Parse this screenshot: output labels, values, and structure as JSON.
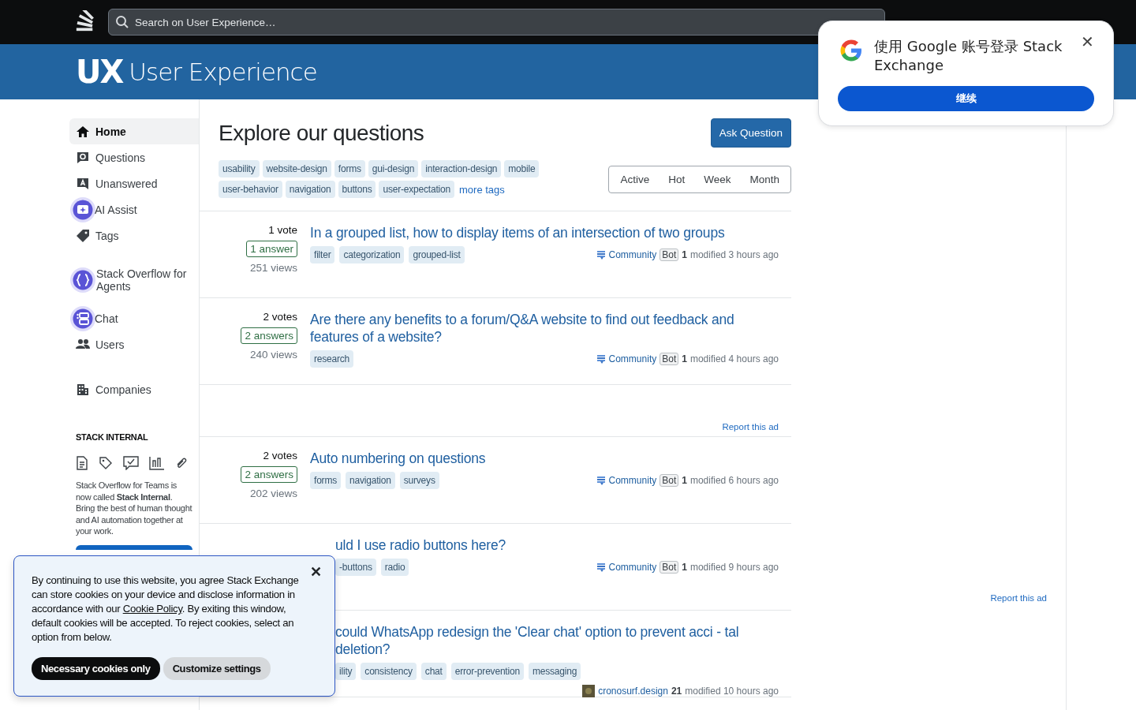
{
  "topbar": {
    "search": {
      "placeholder": "Search on User Experience…"
    }
  },
  "site": {
    "logo_mark": "UX",
    "name": "User Experience"
  },
  "sidebar": {
    "items": [
      {
        "label": "Home",
        "selected": true
      },
      {
        "label": "Questions",
        "selected": false
      },
      {
        "label": "Unanswered",
        "selected": false
      },
      {
        "label": "AI Assist",
        "selected": false
      },
      {
        "label": "Tags",
        "selected": false
      },
      {
        "label": "Stack Overflow for Agents",
        "selected": false
      },
      {
        "label": "Chat",
        "selected": false
      },
      {
        "label": "Users",
        "selected": false
      },
      {
        "label": "Companies",
        "selected": false
      }
    ],
    "internal": {
      "heading": "STACK INTERNAL",
      "text": "Stack Overflow for Teams is now called **Stack Internal**. Bring the best of human thought and AI automation together at your work."
    }
  },
  "main": {
    "title": "Explore our questions",
    "ask_button": "Ask Question",
    "tags": [
      "usability",
      "website-design",
      "forms",
      "gui-design",
      "interaction-design",
      "mobile",
      "user-behavior",
      "navigation",
      "buttons",
      "user-expectation"
    ],
    "more_tags": "more tags",
    "filters": [
      {
        "label": "Active",
        "selected": false
      },
      {
        "label": "Hot",
        "selected": false
      },
      {
        "label": "Week",
        "selected": false
      },
      {
        "label": "Month",
        "selected": false
      }
    ],
    "items": [
      {
        "kind": "question",
        "votes": "1 vote",
        "answers": "1 answer",
        "views": "251 views",
        "title": "In a grouped list, how to display items of an intersection of two groups",
        "tags": [
          "filter",
          "categorization",
          "grouped-list"
        ],
        "user": "Community",
        "badge": "Bot",
        "rep": "1",
        "modified": "modified 3 hours ago"
      },
      {
        "kind": "question",
        "votes": "2 votes",
        "answers": "2 answers",
        "views": "240 views",
        "title": "Are there any benefits to a forum/Q&A website to find out feedback and features of a website?",
        "tags": [
          "research"
        ],
        "user": "Community",
        "badge": "Bot",
        "rep": "1",
        "modified": "modified 4 hours ago"
      },
      {
        "kind": "ad",
        "report": "Report this ad"
      },
      {
        "kind": "question",
        "votes": "2 votes",
        "answers": "2 answers",
        "views": "202 views",
        "title": "Auto numbering on questions",
        "tags": [
          "forms",
          "navigation",
          "surveys"
        ],
        "user": "Community",
        "badge": "Bot",
        "rep": "1",
        "modified": "modified 6 hours ago"
      },
      {
        "kind": "question",
        "title": "uld I use radio buttons here?",
        "tags": [
          "-buttons",
          "radio"
        ],
        "user": "Community",
        "badge": "Bot",
        "rep": "1",
        "modified": "modified 9 hours ago"
      },
      {
        "kind": "question",
        "title": "could WhatsApp redesign the 'Clear chat' option to prevent acci - tal deletion?",
        "tags": [
          "ility",
          "consistency",
          "chat",
          "error-prevention",
          "messaging"
        ],
        "user": "cronosurf.design",
        "rep": "21",
        "modified": "modified 10 hours ago"
      }
    ]
  },
  "right_sidebar": {
    "report": "Report this ad"
  },
  "google_prompt": {
    "title": "使用 Google 账号登录 Stack Exchange",
    "button": "继续",
    "close": "✕"
  },
  "cookie_banner": {
    "text_before": "By continuing to use this website, you agree Stack Exchange can store cookies on your device and disclose information in accordance with our ",
    "link": "Cookie Policy",
    "text_after": ". By exiting this window, default cookies will be accepted. To reject cookies, select an option from below.",
    "buttons": [
      "Necessary cookies only",
      "Customize settings"
    ],
    "close": "✕"
  }
}
